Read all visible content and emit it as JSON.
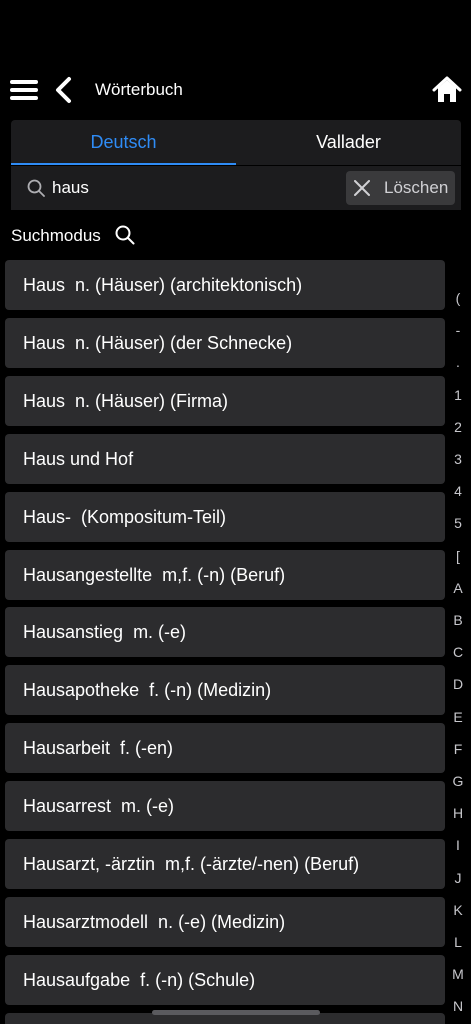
{
  "nav": {
    "title": "Wörterbuch",
    "icons": [
      "menu-icon",
      "back-chevron-icon",
      "home-icon"
    ]
  },
  "tabs": [
    {
      "label": "Deutsch",
      "active": true
    },
    {
      "label": "Vallader",
      "active": false
    }
  ],
  "search": {
    "value": "haus",
    "placeholder": "",
    "clear_label": "Löschen"
  },
  "search_mode": {
    "label": "Suchmodus"
  },
  "results": [
    "Haus  n. (Häuser) (architektonisch)",
    "Haus  n. (Häuser) (der Schnecke)",
    "Haus  n. (Häuser) (Firma)",
    "Haus und Hof",
    "Haus-  (Kompositum-Teil)",
    "Hausangestellte  m,f. (-n) (Beruf)",
    "Hausanstieg  m. (-e)",
    "Hausapotheke  f. (-n) (Medizin)",
    "Hausarbeit  f. (-en)",
    "Hausarrest  m. (-e)",
    "Hausarzt, -ärztin  m,f. (-ärzte/-nen) (Beruf)",
    "Hausarztmodell  n. (-e) (Medizin)",
    "Hausaufgabe  f. (-n) (Schule)",
    ""
  ],
  "index": [
    "(",
    "-",
    ".",
    "1",
    "2",
    "3",
    "4",
    "5",
    "[",
    "A",
    "B",
    "C",
    "D",
    "E",
    "F",
    "G",
    "H",
    "I",
    "J",
    "K",
    "L",
    "M",
    "N"
  ],
  "colors": {
    "accent": "#2f8cf6",
    "background": "#000000",
    "row": "#2c2c2e"
  }
}
